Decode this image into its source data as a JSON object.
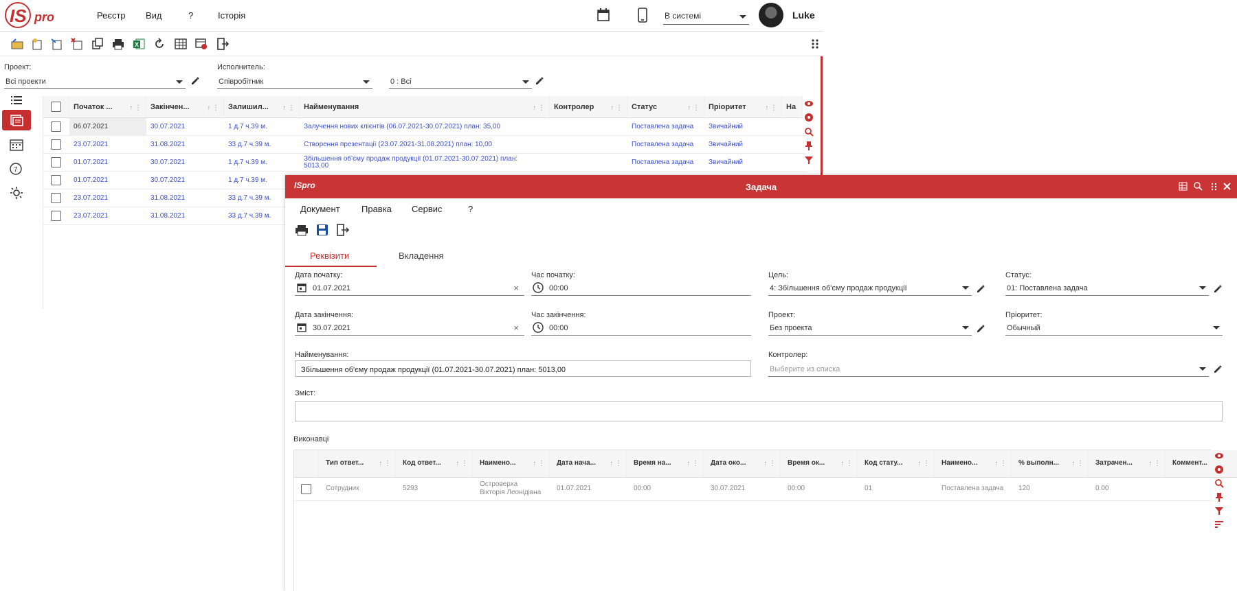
{
  "app": {
    "logo_text": "ISpro",
    "user": "Luke",
    "status_select": "В системі"
  },
  "top_menu": [
    "Реєстр",
    "Вид",
    "?",
    "Історія"
  ],
  "filters": {
    "project_label": "Проект:",
    "project_value": "Всі проекти",
    "executor_label": "Исполнитель:",
    "executor_value": "Співробітник",
    "executor_filter": "0 : Всі"
  },
  "grid": {
    "columns": [
      "Початок ...",
      "Закінчен...",
      "Залишил...",
      "Найменування",
      "Контролер",
      "Статус",
      "Пріоритет",
      "На"
    ],
    "rows": [
      [
        "06.07.2021",
        "30.07.2021",
        "1 д.7 ч.39 м.",
        "Залучення нових клієнтів (06.07.2021-30.07.2021) план: 35,00",
        "",
        "Поставлена задача",
        "Звичайний"
      ],
      [
        "23.07.2021",
        "31.08.2021",
        "33 д.7 ч.39 м.",
        "Створення презентації (23.07.2021-31.08.2021) план: 10,00",
        "",
        "Поставлена задача",
        "Звичайний"
      ],
      [
        "01.07.2021",
        "30.07.2021",
        "1 д.7 ч.39 м.",
        "Збільшення об'єму продаж продукції (01.07.2021-30.07.2021) план:",
        "",
        "Поставлена задача",
        "Звичайний"
      ],
      [
        "01.07.2021",
        "30.07.2021",
        "1 д.7 ч.39 м.",
        "",
        "",
        "",
        ""
      ],
      [
        "23.07.2021",
        "31.08.2021",
        "33 д.7 ч.39 м.",
        "",
        "",
        "",
        ""
      ],
      [
        "23.07.2021",
        "31.08.2021",
        "33 д.7 ч.39 м.",
        "",
        "",
        "",
        ""
      ]
    ],
    "row3_continuation": "5013,00"
  },
  "dialog": {
    "title": "Задача",
    "logo_text": "ISpro",
    "menu": [
      "Документ",
      "Правка",
      "Сервис",
      "?"
    ],
    "tabs": [
      "Реквізити",
      "Вкладення"
    ],
    "fields": {
      "start_date_label": "Дата початку:",
      "start_date": "01.07.2021",
      "start_time_label": "Час початку:",
      "start_time": "00:00",
      "goal_label": "Цель:",
      "goal": "4: Збільшення об'єму продаж продукції",
      "status_label": "Статус:",
      "status": "01: Поставлена задача",
      "end_date_label": "Дата закінчення:",
      "end_date": "30.07.2021",
      "end_time_label": "Час закінчення:",
      "end_time": "00:00",
      "project_label": "Проект:",
      "project": "Без проекта",
      "priority_label": "Пріоритет:",
      "priority": "Обычный",
      "name_label": "Найменування:",
      "name": "Збільшення об'єму продаж продукції (01.07.2021-30.07.2021) план: 5013,00",
      "controller_label": "Контролер:",
      "controller_placeholder": "Выберите из списка",
      "content_label": "Зміст:"
    },
    "executors_label": "Виконавці",
    "exec_columns": [
      "Тип ответ...",
      "Код ответ...",
      "Наимено...",
      "Дата нача...",
      "Время на...",
      "Дата око...",
      "Время ок...",
      "Код стату...",
      "Наимено...",
      "% выполн...",
      "Затрачен...",
      "Коммент..."
    ],
    "exec_row": [
      "Сотрудник",
      "5293",
      "Островерха Вікторія Леонідівна",
      "01.07.2021",
      "00:00",
      "30.07.2021",
      "00:00",
      "01",
      "Поставлена задача",
      "120",
      "0.00",
      ""
    ]
  },
  "colors": {
    "brand_red": "#c93535",
    "link_blue": "#3a4fd0"
  }
}
